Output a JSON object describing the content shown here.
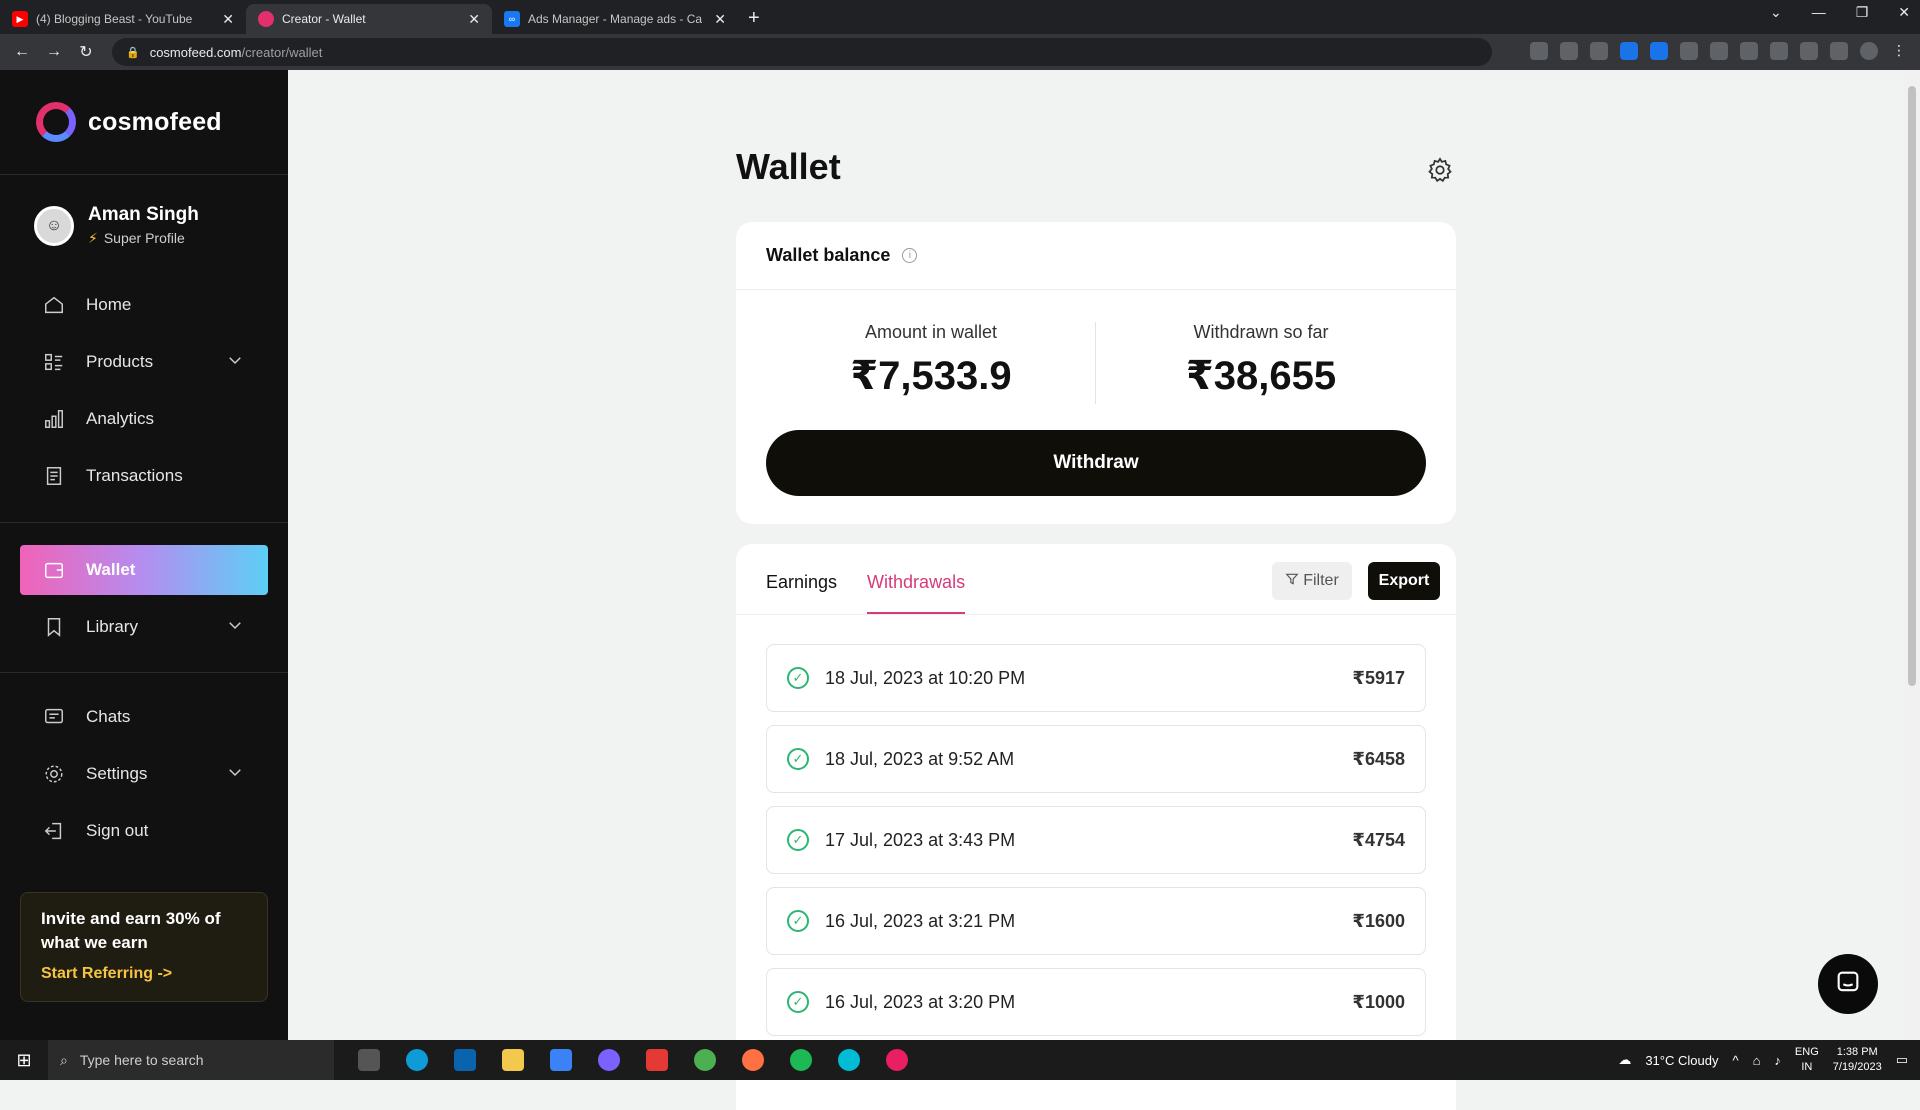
{
  "browser": {
    "tabs": [
      {
        "title": "(4) Blogging Beast - YouTube",
        "active": false
      },
      {
        "title": "Creator - Wallet",
        "active": true
      },
      {
        "title": "Ads Manager - Manage ads - Ca",
        "active": false
      }
    ],
    "url_host": "cosmofeed.com",
    "url_path": "/creator/wallet"
  },
  "sidebar": {
    "brand": "cosmofeed",
    "user": {
      "name": "Aman Singh",
      "badge": "Super Profile"
    },
    "items": [
      {
        "label": "Home",
        "icon": "home-icon"
      },
      {
        "label": "Products",
        "icon": "products-icon"
      },
      {
        "label": "Analytics",
        "icon": "analytics-icon"
      },
      {
        "label": "Transactions",
        "icon": "transactions-icon"
      },
      {
        "label": "Wallet",
        "icon": "wallet-icon"
      },
      {
        "label": "Library",
        "icon": "bookmark-icon"
      },
      {
        "label": "Chats",
        "icon": "chat-icon"
      },
      {
        "label": "Settings",
        "icon": "gear-icon"
      },
      {
        "label": "Sign out",
        "icon": "sign-out-icon"
      }
    ],
    "invite": {
      "title": "Invite and earn 30% of what we earn",
      "link": "Start Referring ->"
    }
  },
  "wallet": {
    "title": "Wallet",
    "balance_heading": "Wallet balance",
    "amount_label": "Amount in wallet",
    "amount_value": "₹7,533.9",
    "withdrawn_label": "Withdrawn so far",
    "withdrawn_value": "₹38,655",
    "withdraw_button": "Withdraw"
  },
  "history": {
    "tabs": [
      {
        "label": "Earnings",
        "active": false
      },
      {
        "label": "Withdrawals",
        "active": true
      }
    ],
    "filter_label": "Filter",
    "export_label": "Export",
    "rows": [
      {
        "date": "18 Jul, 2023 at 10:20 PM",
        "amount": "₹5917"
      },
      {
        "date": "18 Jul, 2023 at 9:52 AM",
        "amount": "₹6458"
      },
      {
        "date": "17 Jul, 2023 at 3:43 PM",
        "amount": "₹4754"
      },
      {
        "date": "16 Jul, 2023 at 3:21 PM",
        "amount": "₹1600"
      },
      {
        "date": "16 Jul, 2023 at 3:20 PM",
        "amount": "₹1000"
      }
    ]
  },
  "taskbar": {
    "search_placeholder": "Type here to search",
    "weather": "31°C  Cloudy",
    "lang": "ENG",
    "region": "IN",
    "time": "1:38 PM",
    "date": "7/19/2023"
  },
  "colors": {
    "accent_pink": "#d63a7a",
    "success_green": "#2bb673",
    "dark_button": "#0f0e09",
    "sidebar_bg": "#111111"
  }
}
